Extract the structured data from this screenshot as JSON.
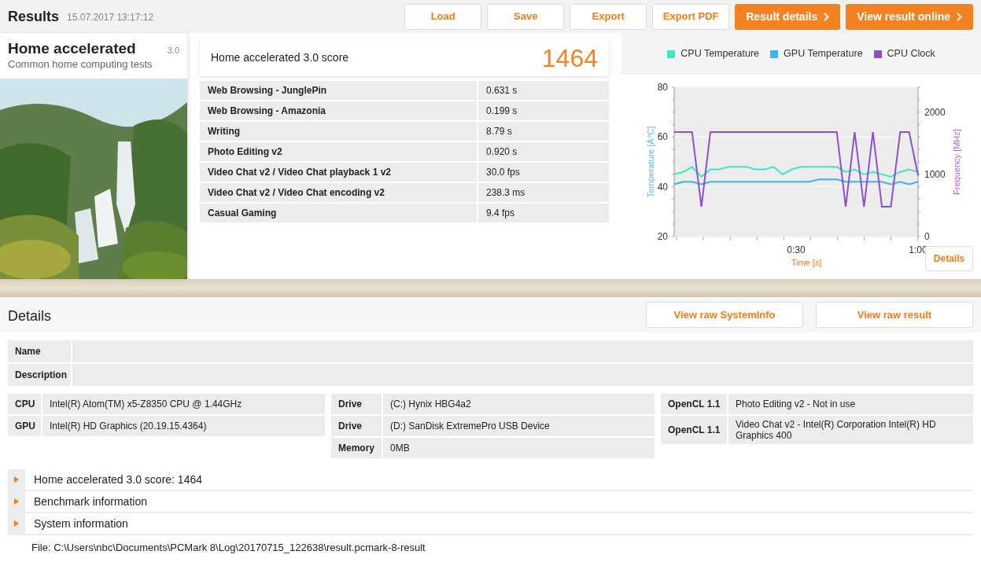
{
  "header": {
    "title": "Results",
    "timestamp": "15.07.2017 13:17:12",
    "buttons": [
      {
        "label": "Load",
        "kind": "plain"
      },
      {
        "label": "Save",
        "kind": "plain"
      },
      {
        "label": "Export",
        "kind": "plain"
      },
      {
        "label": "Export PDF",
        "kind": "plain"
      },
      {
        "label": "Result details",
        "kind": "primary"
      },
      {
        "label": "View result online",
        "kind": "primary"
      }
    ]
  },
  "test": {
    "name": "Home accelerated",
    "version": "3.0",
    "subtitle": "Common home computing tests"
  },
  "score": {
    "label": "Home accelerated 3.0 score",
    "value": "1464"
  },
  "results": [
    {
      "name": "Web Browsing - JunglePin",
      "value": "0.631 s"
    },
    {
      "name": "Web Browsing - Amazonia",
      "value": "0.199 s"
    },
    {
      "name": "Writing",
      "value": "8.79 s"
    },
    {
      "name": "Photo Editing v2",
      "value": "0.920 s"
    },
    {
      "name": "Video Chat v2 / Video Chat playback 1 v2",
      "value": "30.0 fps"
    },
    {
      "name": "Video Chat v2 / Video Chat encoding v2",
      "value": "238.3 ms"
    },
    {
      "name": "Casual Gaming",
      "value": "9.4 fps"
    }
  ],
  "monitoring": {
    "details_button": "Details",
    "chart_data": {
      "type": "line",
      "xlabel": "Time [s]",
      "ylabel": "Temperature [Â°C]",
      "y2label": "Frequency [MHz]",
      "x": [
        0,
        2.2,
        4.4,
        6.7,
        8.9,
        11.1,
        13.3,
        15.6,
        17.8,
        20,
        22.2,
        24.4,
        26.7,
        28.9,
        31.1,
        33.3,
        35.6,
        37.8,
        40,
        42.2,
        44.4,
        46.7,
        48.9,
        51.1,
        53.3,
        55.6,
        57.8,
        60
      ],
      "xlim": [
        0,
        60
      ],
      "xticks": [
        {
          "value": 30,
          "label": "0:30"
        },
        {
          "value": 60,
          "label": "1:00"
        }
      ],
      "ylim": [
        20,
        80
      ],
      "yticks": [
        20,
        40,
        60,
        80
      ],
      "y2lim": [
        0,
        2400
      ],
      "y2ticks": [
        0,
        1000,
        2000
      ],
      "series": [
        {
          "name": "CPU Temperature",
          "color": "#3ee8c0",
          "values": [
            45,
            46,
            48,
            44,
            47,
            47,
            48,
            48,
            48,
            47,
            47,
            48,
            45,
            47,
            48,
            48,
            48,
            48,
            48,
            46,
            47,
            45,
            46,
            45,
            44,
            46,
            47,
            46
          ]
        },
        {
          "name": "GPU Temperature",
          "color": "#3bb4f0",
          "values": [
            41,
            42,
            42,
            41,
            42,
            42,
            42,
            42,
            42,
            42,
            42,
            42,
            42,
            42,
            42,
            42,
            43,
            43,
            43,
            42,
            42,
            42,
            42,
            42,
            41,
            42,
            41,
            42
          ]
        },
        {
          "name": "CPU Clock",
          "color": "#8e4fcf",
          "axis": "y2",
          "values": [
            1680,
            1680,
            1680,
            480,
            1680,
            1680,
            1680,
            1680,
            1680,
            1680,
            1680,
            1680,
            1680,
            1680,
            1680,
            1680,
            1680,
            1680,
            1680,
            480,
            1680,
            480,
            1680,
            480,
            480,
            1680,
            1680,
            980
          ]
        }
      ]
    }
  },
  "details": {
    "title": "Details",
    "buttons": [
      "View raw SystemInfo",
      "View raw result"
    ],
    "info_rows": [
      {
        "label": "Name"
      },
      {
        "label": "Description"
      }
    ],
    "system_columns": [
      [
        {
          "label": "CPU",
          "value": "Intel(R) Atom(TM) x5-Z8350  CPU @ 1.44GHz"
        },
        {
          "label": "GPU",
          "value": "Intel(R) HD Graphics (20.19.15.4364)"
        }
      ],
      [
        {
          "label": "Drive",
          "value": "(C:) Hynix HBG4a2"
        },
        {
          "label": "Drive",
          "value": "(D:) SanDisk ExtremePro USB Device"
        },
        {
          "label": "Memory",
          "value": "0MB"
        }
      ],
      [
        {
          "label": "OpenCL 1.1",
          "value": "Photo Editing v2 - Not in use"
        },
        {
          "label": "OpenCL 1.1",
          "value": "Video Chat v2 - Intel(R) Corporation Intel(R) HD Graphics 400"
        }
      ]
    ],
    "sections": [
      {
        "label": "Home accelerated 3.0 score: 1464",
        "expanded": false
      },
      {
        "label": "Benchmark information",
        "expanded": false
      },
      {
        "label": "System information",
        "expanded": false
      }
    ],
    "file": "File: C:\\Users\\nbc\\Documents\\PCMark 8\\Log\\20170715_122638\\result.pcmark-8-result"
  }
}
